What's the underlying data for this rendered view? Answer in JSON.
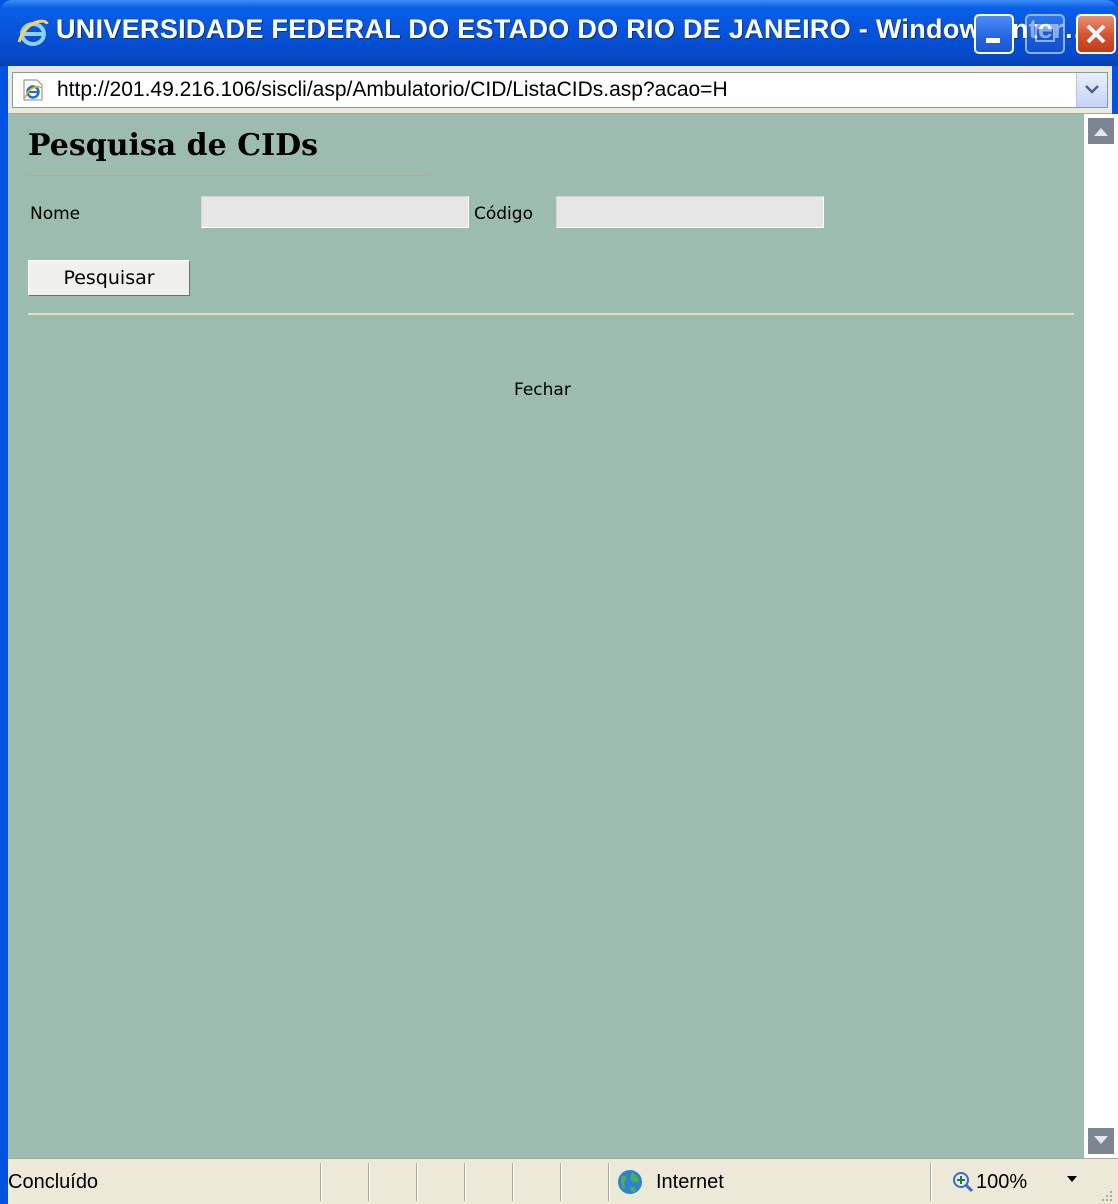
{
  "window": {
    "title": "UNIVERSIDADE FEDERAL DO ESTADO DO RIO DE JANEIRO - Windows Inter…",
    "icons": {
      "title": "ie-logo-icon",
      "minimize": "minimize-icon",
      "maximize": "maximize-icon",
      "close": "close-icon"
    }
  },
  "address_bar": {
    "url": "http://201.49.216.106/siscli/asp/Ambulatorio/CID/ListaCIDs.asp?acao=H",
    "icon": "ie-page-icon"
  },
  "page": {
    "title": "Pesquisa de CIDs",
    "form": {
      "nome_label": "Nome",
      "nome_value": "",
      "codigo_label": "Código",
      "codigo_value": "",
      "search_button": "Pesquisar"
    },
    "close_link": "Fechar"
  },
  "status_bar": {
    "status": "Concluído",
    "zone": "Internet",
    "zoom": "100%"
  },
  "colors": {
    "page_background": "#9bbcae",
    "titlebar": "#0652d8",
    "chrome": "#ece9d8",
    "field_background": "#e6e6e6"
  }
}
